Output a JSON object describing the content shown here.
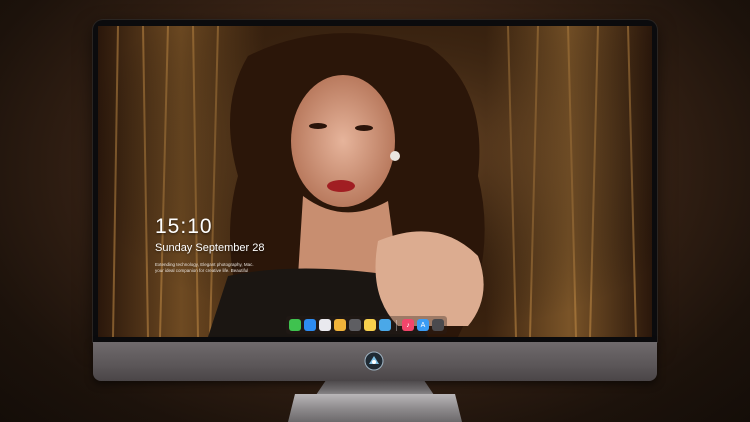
{
  "lockscreen": {
    "time": "15:10",
    "date": "Sunday September 28",
    "note_line1": "Extending technology, Elegant photography, Mac.",
    "note_line2": "your ideal companion for creative life. Beautiful"
  },
  "dock": {
    "items": [
      {
        "name": "messages-icon",
        "color": "#3fc24f",
        "glyph": ""
      },
      {
        "name": "finder-icon",
        "color": "#2d8cf0",
        "glyph": ""
      },
      {
        "name": "safari-icon",
        "color": "#e9e9ee",
        "glyph": ""
      },
      {
        "name": "photos-icon",
        "color": "#f1b43a",
        "glyph": ""
      },
      {
        "name": "clapper-icon",
        "color": "#5e5e62",
        "glyph": ""
      },
      {
        "name": "notes-icon",
        "color": "#f6d04d",
        "glyph": ""
      },
      {
        "name": "preview-icon",
        "color": "#4aa8e8",
        "glyph": ""
      },
      {
        "name": "music-icon",
        "color": "#f2456b",
        "glyph": "♪"
      },
      {
        "name": "appstore-icon",
        "color": "#3a9cf4",
        "glyph": "A"
      },
      {
        "name": "screenshot-icon",
        "color": "#4a4a4e",
        "glyph": ""
      }
    ]
  },
  "colors": {
    "background": "#3a2416",
    "chin": "#5b5658"
  }
}
